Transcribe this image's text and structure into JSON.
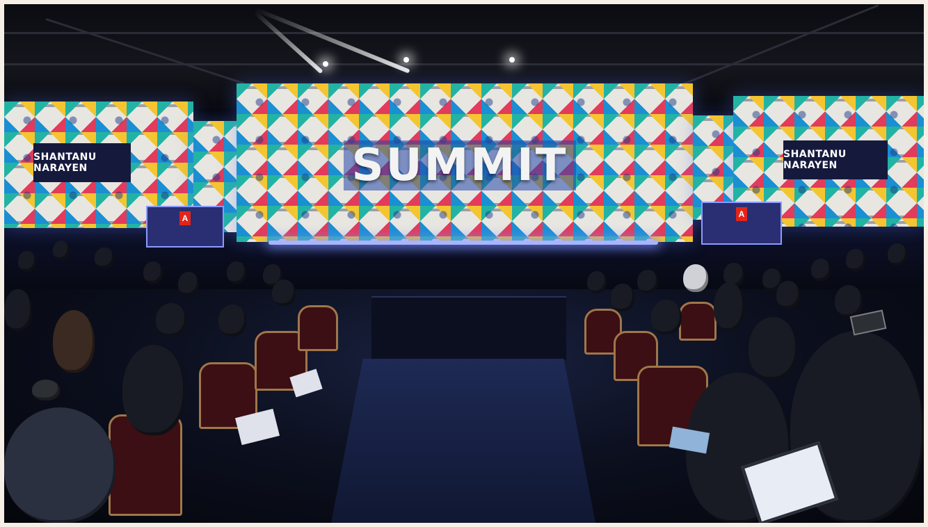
{
  "scene": {
    "left_name_plate": "SHANTANU NARAYEN",
    "right_name_plate": "SHANTANU NARAYEN",
    "main_title": "SUMMIT",
    "podium_logo": "A"
  },
  "colors": {
    "screen_blue": "#1a8fd1",
    "screen_red": "#e23b5b",
    "screen_yellow": "#f4c531",
    "screen_teal": "#23b3a5",
    "plate_navy": "#151a3d",
    "chair_red": "#3b0f14",
    "adobe_red": "#e1251b"
  },
  "icons": [
    "adobe-logo-icon"
  ]
}
